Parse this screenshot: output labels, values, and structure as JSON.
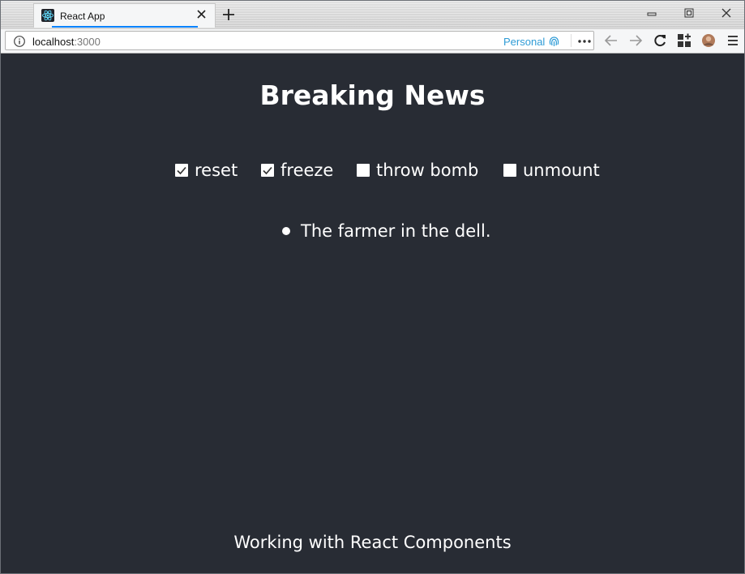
{
  "browser": {
    "tab_title": "React App",
    "url_host": "localhost",
    "url_port": ":3000",
    "container_label": "Personal",
    "accent_color": "#0a84ff",
    "container_color": "#2e9bd6"
  },
  "page": {
    "background": "#282c34",
    "title": "Breaking News",
    "controls": [
      {
        "label": "reset",
        "checked": true
      },
      {
        "label": "freeze",
        "checked": true
      },
      {
        "label": "throw bomb",
        "checked": false
      },
      {
        "label": "unmount",
        "checked": false
      }
    ],
    "news": [
      "The farmer in the dell."
    ],
    "footer": "Working with React Components"
  }
}
